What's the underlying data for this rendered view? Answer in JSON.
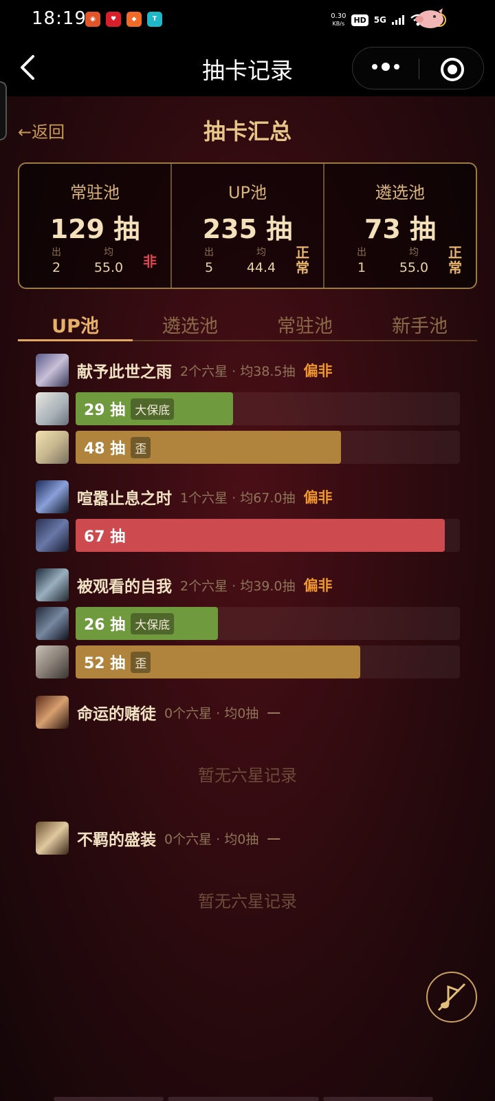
{
  "status": {
    "time": "18:19",
    "netspeed_value": "0.30",
    "netspeed_unit": "KB/s",
    "hd": "HD",
    "network": "5G"
  },
  "nav": {
    "title": "抽卡记录"
  },
  "header": {
    "back_label": "←返回",
    "title": "抽卡汇总"
  },
  "summary": [
    {
      "name": "常驻池",
      "count": "129 抽",
      "out_label": "出",
      "out": "2",
      "avg_label": "均",
      "avg": "55.0",
      "tag": "非"
    },
    {
      "name": "UP池",
      "count": "235 抽",
      "out_label": "出",
      "out": "5",
      "avg_label": "均",
      "avg": "44.4",
      "tag": "正常"
    },
    {
      "name": "遴选池",
      "count": "73 抽",
      "out_label": "出",
      "out": "1",
      "avg_label": "均",
      "avg": "55.0",
      "tag": "正常"
    }
  ],
  "tabs": [
    "UP池",
    "遴选池",
    "常驻池",
    "新手池"
  ],
  "groups": [
    {
      "name": "献予此世之雨",
      "stat": "2个六星 · 均38.5抽",
      "verdict": "偏非",
      "pulls": [
        {
          "count": "29 抽",
          "badge": "大保底",
          "fraction": 0.41
        },
        {
          "count": "48 抽",
          "badge": "歪",
          "fraction": 0.69
        }
      ]
    },
    {
      "name": "喧嚣止息之时",
      "stat": "1个六星 · 均67.0抽",
      "verdict": "偏非",
      "pulls": [
        {
          "count": "67 抽",
          "badge": "",
          "fraction": 0.96
        }
      ]
    },
    {
      "name": "被观看的自我",
      "stat": "2个六星 · 均39.0抽",
      "verdict": "偏非",
      "pulls": [
        {
          "count": "26 抽",
          "badge": "大保底",
          "fraction": 0.37
        },
        {
          "count": "52 抽",
          "badge": "歪",
          "fraction": 0.74
        }
      ]
    },
    {
      "name": "命运的赌徒",
      "stat": "0个六星 · 均0抽",
      "verdict": "—",
      "empty": "暂无六星记录"
    },
    {
      "name": "不羁的盛装",
      "stat": "0个六星 · 均0抽",
      "verdict": "—",
      "empty": "暂无六星记录"
    }
  ],
  "colors": {
    "accent": "#e7b06a",
    "verdict": "#f0962e",
    "bar_guarantee": "#6f9b3e",
    "bar_off": "#b0843c",
    "bar_plain": "#cd4a4f"
  },
  "icons": [
    "back-chevron-icon",
    "more-dots-icon",
    "close-target-icon",
    "music-off-icon"
  ]
}
